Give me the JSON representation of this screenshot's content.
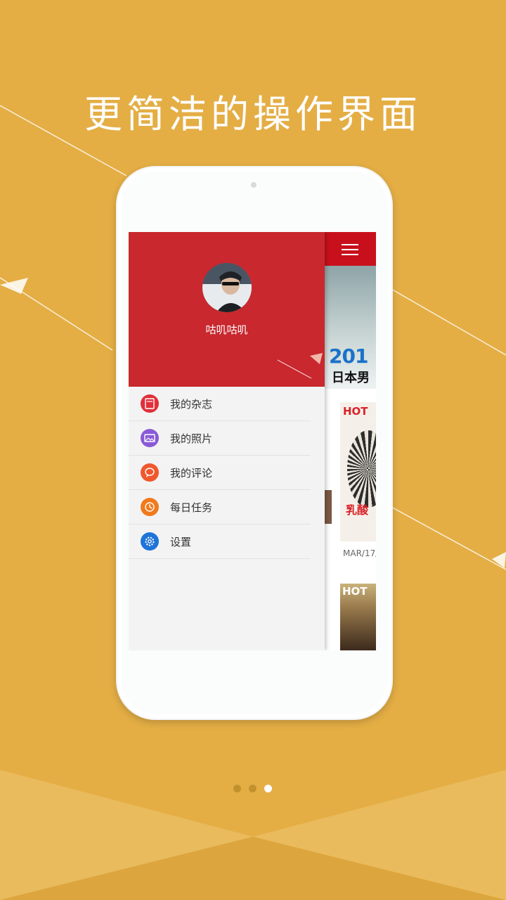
{
  "headline": "更简洁的操作界面",
  "colors": {
    "background": "#E4AE45",
    "drawer_header": "#C8282E",
    "app_bar": "#C8101C"
  },
  "drawer": {
    "username": "咕叽咕叽",
    "menu": [
      {
        "label": "我的杂志",
        "icon": "magazine-icon",
        "color": "#E0303A"
      },
      {
        "label": "我的照片",
        "icon": "photo-icon",
        "color": "#8A5AD6"
      },
      {
        "label": "我的评论",
        "icon": "comment-icon",
        "color": "#F0582E"
      },
      {
        "label": "每日任务",
        "icon": "clock-icon",
        "color": "#F07A1E"
      },
      {
        "label": "设置",
        "icon": "gear-icon",
        "color": "#1E74D8"
      }
    ]
  },
  "app": {
    "banner_text": "201",
    "banner_subtext": "日本男",
    "magazine_logo": "HOT",
    "magazine_red_text": "乳酸",
    "date_label": "MAR/17/",
    "magazine2_logo": "HOT"
  },
  "pager": {
    "count": 3,
    "active_index": 2
  }
}
